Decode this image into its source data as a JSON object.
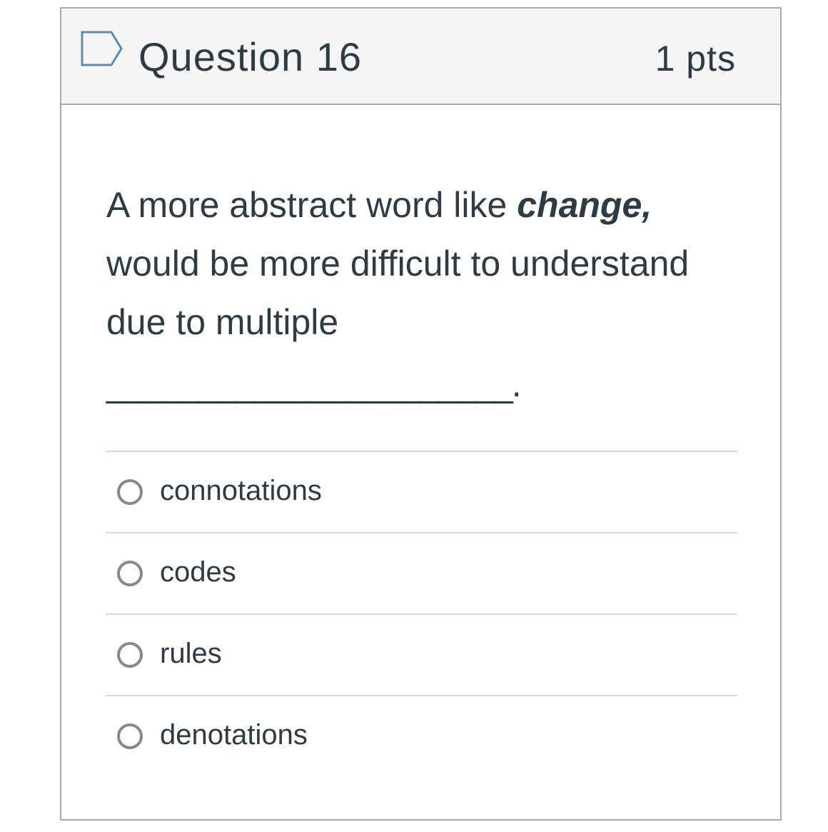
{
  "question": {
    "title": "Question 16",
    "points": "1 pts",
    "flag_icon": "flag-outline-icon",
    "text_before": "A more abstract word like ",
    "text_emphasis": "change,",
    "text_after": " would be more difficult to understand due to multiple",
    "blank": "______________________."
  },
  "answers": [
    {
      "label": "connotations",
      "selected": false
    },
    {
      "label": "codes",
      "selected": false
    },
    {
      "label": "rules",
      "selected": false
    },
    {
      "label": "denotations",
      "selected": false
    }
  ],
  "colors": {
    "text": "#2d3b45",
    "header_bg": "#f5f5f5",
    "border": "#aaaaaa",
    "divider": "#dcdcdc",
    "radio_border": "#888888",
    "flag_stroke": "#5a8bb0"
  }
}
